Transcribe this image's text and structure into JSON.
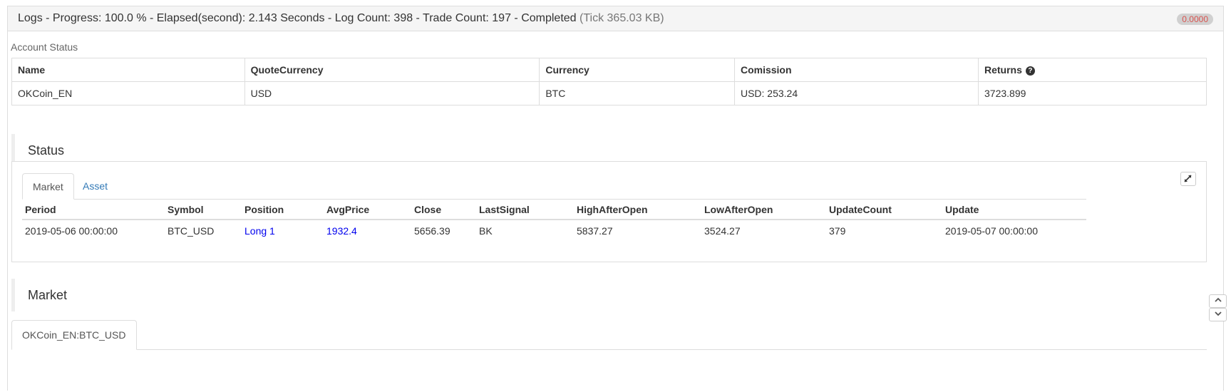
{
  "header": {
    "status_text": "Logs - Progress: 100.0 % - Elapsed(second): 2.143 Seconds - Log Count: 398 - Trade Count: 197 - Completed",
    "tick_text": "(Tick 365.03 KB)",
    "badge_value": "0.0000",
    "badge_color": "#d9534f"
  },
  "account": {
    "label": "Account Status",
    "columns": [
      "Name",
      "QuoteCurrency",
      "Currency",
      "Comission",
      "Returns"
    ],
    "row": [
      "OKCoin_EN",
      "USD",
      "BTC",
      "USD: 253.24",
      "3723.899"
    ],
    "returns_help_icon": "question-circle-icon"
  },
  "status": {
    "title": "Status",
    "tabs": [
      "Market",
      "Asset"
    ],
    "expand_icon": "expand-arrows-icon",
    "columns": [
      "Period",
      "Symbol",
      "Position",
      "AvgPrice",
      "Close",
      "LastSignal",
      "HighAfterOpen",
      "LowAfterOpen",
      "UpdateCount",
      "Update"
    ],
    "row": [
      "2019-05-06 00:00:00",
      "BTC_USD",
      "Long 1",
      "1932.4",
      "5656.39",
      "BK",
      "5837.27",
      "3524.27",
      "379",
      "2019-05-07 00:00:00"
    ],
    "link_color": "#0000ee"
  },
  "market": {
    "title": "Market",
    "tab": "OKCoin_EN:BTC_USD"
  },
  "scroll": {
    "up_icon": "chevron-up-icon",
    "down_icon": "chevron-down-icon"
  }
}
